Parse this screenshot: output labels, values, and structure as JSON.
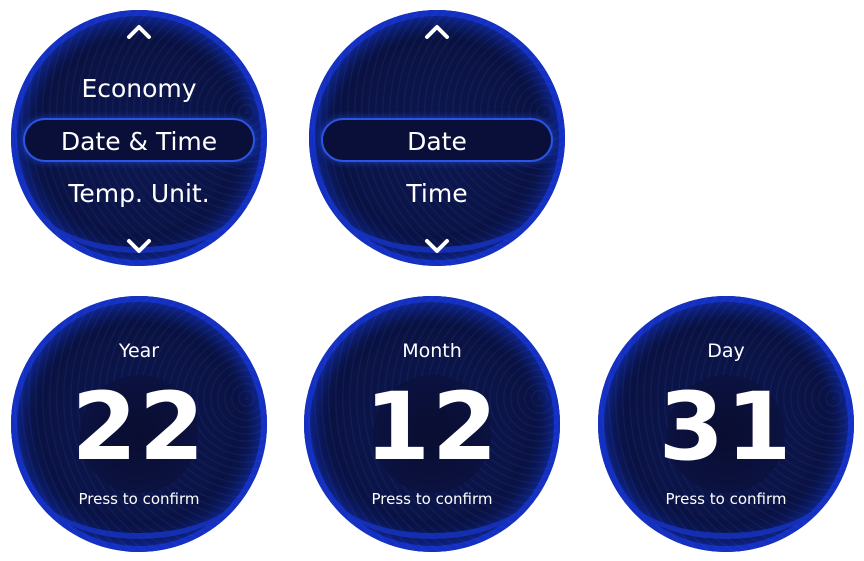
{
  "menu_main": {
    "items": [
      "Economy",
      "Date & Time",
      "Temp. Unit."
    ],
    "selected_index": 1
  },
  "menu_date_time": {
    "items": [
      "Date",
      "Time"
    ],
    "selected_index": 0
  },
  "setters": [
    {
      "label": "Year",
      "value": "22",
      "hint": "Press to confirm"
    },
    {
      "label": "Month",
      "value": "12",
      "hint": "Press to confirm"
    },
    {
      "label": "Day",
      "value": "31",
      "hint": "Press to confirm"
    }
  ],
  "icons": {
    "up": "chevron-up-icon",
    "down": "chevron-down-icon"
  },
  "colors": {
    "ring": "#1a3fd6",
    "face": "#0b1446",
    "selection_border": "#2b55e6",
    "text": "#ffffff"
  }
}
